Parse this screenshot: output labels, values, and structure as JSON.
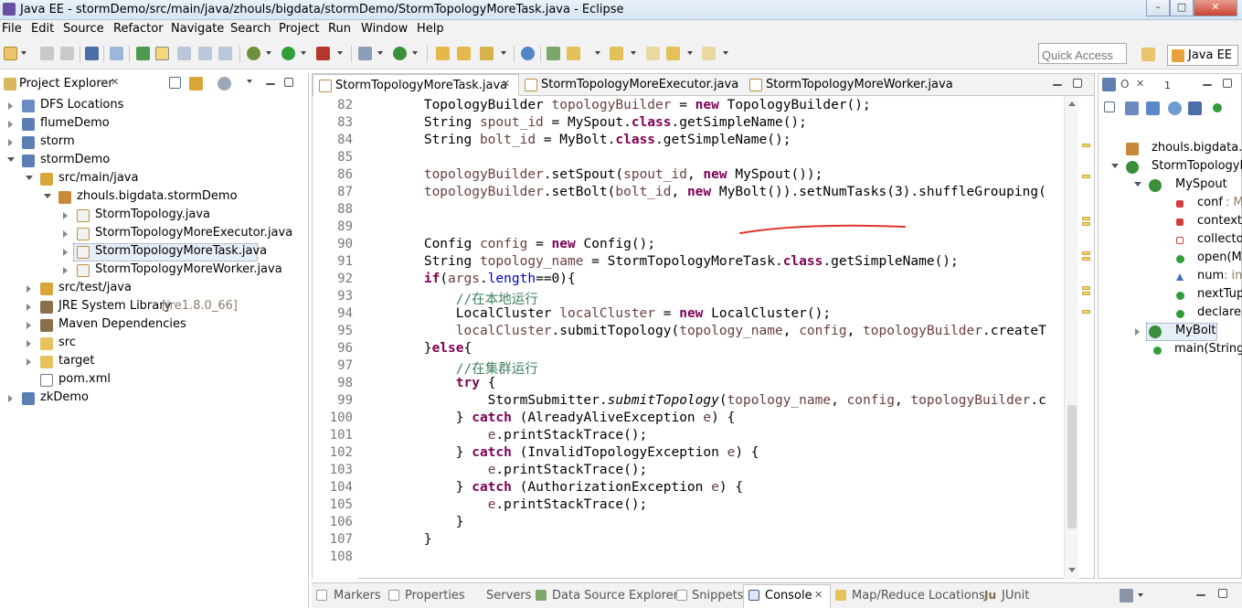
{
  "window": {
    "title": "Java EE - stormDemo/src/main/java/zhouls/bigdata/stormDemo/StormTopologyMoreTask.java - Eclipse",
    "minimize": "–",
    "maximize": "□",
    "close": "✕"
  },
  "menu": [
    "File",
    "Edit",
    "Source",
    "Refactor",
    "Navigate",
    "Search",
    "Project",
    "Run",
    "Window",
    "Help"
  ],
  "toolbar": {
    "quick_access_placeholder": "Quick Access",
    "perspective": "Java EE"
  },
  "project_explorer": {
    "title": "Project Explorer",
    "close": "✕",
    "items": [
      {
        "label": "DFS Locations"
      },
      {
        "label": "flumeDemo"
      },
      {
        "label": "storm"
      },
      {
        "label": "stormDemo"
      },
      {
        "label": "src/main/java"
      },
      {
        "label": "zhouls.bigdata.stormDemo"
      },
      {
        "label": "StormTopology.java"
      },
      {
        "label": "StormTopologyMoreExecutor.java"
      },
      {
        "label": "StormTopologyMoreTask.java"
      },
      {
        "label": "StormTopologyMoreWorker.java"
      },
      {
        "label": "src/test/java"
      },
      {
        "label": "JRE System Library",
        "detail": "[jre1.8.0_66]"
      },
      {
        "label": "Maven Dependencies"
      },
      {
        "label": "src"
      },
      {
        "label": "target"
      },
      {
        "label": "pom.xml"
      },
      {
        "label": "zkDemo"
      }
    ]
  },
  "editor": {
    "tabs": [
      {
        "label": "StormTopologyMoreTask.java",
        "active": true,
        "close": "✕"
      },
      {
        "label": "StormTopologyMoreExecutor.java",
        "active": false
      },
      {
        "label": "StormTopologyMoreWorker.java",
        "active": false
      }
    ],
    "line_numbers": [
      "82",
      "83",
      "84",
      "85",
      "86",
      "87",
      "88",
      "89",
      "90",
      "91",
      "92",
      "93",
      "94",
      "95",
      "96",
      "97",
      "98",
      "99",
      "100",
      "101",
      "102",
      "103",
      "104",
      "105",
      "106",
      "107",
      "108"
    ],
    "lines": [
      "        TopologyBuilder topologyBuilder = new TopologyBuilder();",
      "        String spout_id = MySpout.class.getSimpleName();",
      "        String bolt_id = MyBolt.class.getSimpleName();",
      "",
      "        topologyBuilder.setSpout(spout_id, new MySpout());",
      "        topologyBuilder.setBolt(bolt_id, new MyBolt()).setNumTasks(3).shuffleGrouping(",
      "",
      "",
      "        Config config = new Config();",
      "        String topology_name = StormTopologyMoreTask.class.getSimpleName();",
      "        if(args.length==0){",
      "            //在本地运行",
      "            LocalCluster localCluster = new LocalCluster();",
      "            localCluster.submitTopology(topology_name, config, topologyBuilder.createT",
      "        }else{",
      "            //在集群运行",
      "            try {",
      "                StormSubmitter.submitTopology(topology_name, config, topologyBuilder.c",
      "            } catch (AlreadyAliveException e) {",
      "                e.printStackTrace();",
      "            } catch (InvalidTopologyException e) {",
      "                e.printStackTrace();",
      "            } catch (AuthorizationException e) {",
      "                e.printStackTrace();",
      "            }",
      "        }",
      ""
    ]
  },
  "outline": {
    "tab_label": "1",
    "items": [
      {
        "label": "zhouls.bigdata.s"
      },
      {
        "label": "StormTopologyM"
      },
      {
        "label": "MySpout"
      },
      {
        "label": "conf",
        "detail": ": M"
      },
      {
        "label": "context"
      },
      {
        "label": "collecto"
      },
      {
        "label": "open(M"
      },
      {
        "label": "num",
        "detail": ": in"
      },
      {
        "label": "nextTup"
      },
      {
        "label": "declare"
      },
      {
        "label": "MyBolt"
      },
      {
        "label": "main(String["
      }
    ]
  },
  "bottom_tabs": [
    "Markers",
    "Properties",
    "Servers",
    "Data Source Explorer",
    "Snippets",
    "Console",
    "Map/Reduce Locations",
    "JUnit"
  ],
  "active_bottom_tab": "Console",
  "colors": {
    "keyword": "#7f0055",
    "field": "#0000c0",
    "local_variable": "#6a3e3e",
    "comment": "#3f7f5f",
    "annotation_stroke": "#e0352b"
  }
}
